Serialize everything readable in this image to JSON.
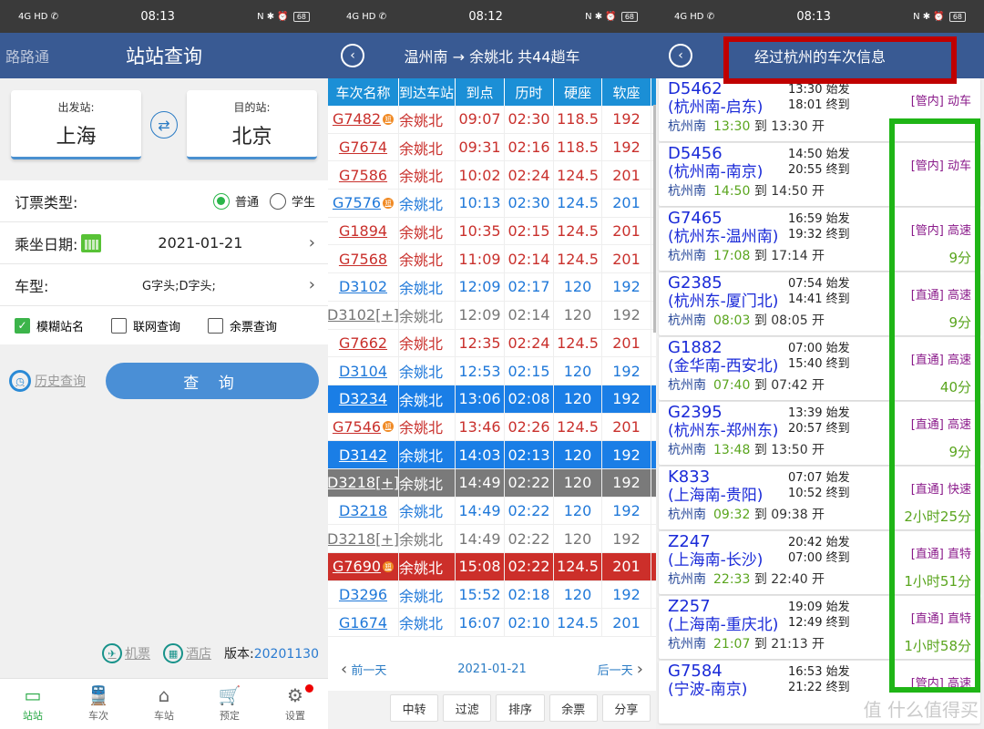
{
  "panel1": {
    "status": {
      "time": "08:13",
      "left": "4G HD ✆",
      "right": "N ✱ ⏰",
      "battery": "68"
    },
    "header": {
      "app_name": "路路通",
      "title": "站站查询"
    },
    "from": {
      "label": "出发站:",
      "value": "上海"
    },
    "to": {
      "label": "目的站:",
      "value": "北京"
    },
    "swap_icon": "⇄",
    "ticket_type": {
      "label": "订票类型:",
      "options": [
        "普通",
        "学生"
      ],
      "selected": "普通"
    },
    "date": {
      "label": "乘坐日期:",
      "value": "2021-01-21"
    },
    "train_type": {
      "label": "车型:",
      "value": "G字头;D字头;"
    },
    "checkboxes": [
      {
        "label": "模糊站名",
        "checked": true
      },
      {
        "label": "联网查询",
        "checked": false
      },
      {
        "label": "余票查询",
        "checked": false
      }
    ],
    "history_label": "历史查询",
    "query_label": "查 询",
    "links": {
      "flight": "机票",
      "hotel": "酒店",
      "version_label": "版本:",
      "version": "20201130"
    },
    "tabs": [
      {
        "label": "站站",
        "icon": "▭",
        "active": true
      },
      {
        "label": "车次",
        "icon": "🚆",
        "active": false
      },
      {
        "label": "车站",
        "icon": "⌂",
        "active": false
      },
      {
        "label": "预定",
        "icon": "🛒",
        "active": false
      },
      {
        "label": "设置",
        "icon": "⚙",
        "active": false
      }
    ]
  },
  "panel2": {
    "status": {
      "time": "08:12",
      "left": "4G HD ✆",
      "right": "N ✱ ⏰",
      "battery": "68"
    },
    "title": "温州南 → 余姚北 共44趟车",
    "columns": [
      "车次名称",
      "到达车站",
      "到点",
      "历时",
      "硬座",
      "软座"
    ],
    "rows": [
      {
        "train": "G7482",
        "badge": true,
        "station": "余姚北",
        "arrive": "09:07",
        "duration": "02:30",
        "hard": "118.5",
        "soft": "192",
        "style": "red"
      },
      {
        "train": "G7674",
        "badge": false,
        "station": "余姚北",
        "arrive": "09:31",
        "duration": "02:16",
        "hard": "118.5",
        "soft": "192",
        "style": "red"
      },
      {
        "train": "G7586",
        "badge": false,
        "station": "余姚北",
        "arrive": "10:02",
        "duration": "02:24",
        "hard": "124.5",
        "soft": "201",
        "style": "red"
      },
      {
        "train": "G7576",
        "badge": true,
        "station": "余姚北",
        "arrive": "10:13",
        "duration": "02:30",
        "hard": "124.5",
        "soft": "201",
        "style": "blue"
      },
      {
        "train": "G1894",
        "badge": false,
        "station": "余姚北",
        "arrive": "10:35",
        "duration": "02:15",
        "hard": "124.5",
        "soft": "201",
        "style": "red"
      },
      {
        "train": "G7568",
        "badge": false,
        "station": "余姚北",
        "arrive": "11:09",
        "duration": "02:14",
        "hard": "124.5",
        "soft": "201",
        "style": "red"
      },
      {
        "train": "D3102",
        "badge": false,
        "station": "余姚北",
        "arrive": "12:09",
        "duration": "02:17",
        "hard": "120",
        "soft": "192",
        "style": "blue"
      },
      {
        "train": "D3102[+]",
        "badge": false,
        "station": "余姚北",
        "arrive": "12:09",
        "duration": "02:14",
        "hard": "120",
        "soft": "192",
        "style": "gray"
      },
      {
        "train": "G7662",
        "badge": false,
        "station": "余姚北",
        "arrive": "12:35",
        "duration": "02:24",
        "hard": "124.5",
        "soft": "201",
        "style": "red"
      },
      {
        "train": "D3104",
        "badge": false,
        "station": "余姚北",
        "arrive": "12:53",
        "duration": "02:15",
        "hard": "120",
        "soft": "192",
        "style": "blue"
      },
      {
        "train": "D3234",
        "badge": false,
        "station": "余姚北",
        "arrive": "13:06",
        "duration": "02:08",
        "hard": "120",
        "soft": "192",
        "style": "sel-blue"
      },
      {
        "train": "G7546",
        "badge": true,
        "station": "余姚北",
        "arrive": "13:46",
        "duration": "02:26",
        "hard": "124.5",
        "soft": "201",
        "style": "red"
      },
      {
        "train": "D3142",
        "badge": false,
        "station": "余姚北",
        "arrive": "14:03",
        "duration": "02:13",
        "hard": "120",
        "soft": "192",
        "style": "sel-blue"
      },
      {
        "train": "D3218[+]",
        "badge": false,
        "station": "余姚北",
        "arrive": "14:49",
        "duration": "02:22",
        "hard": "120",
        "soft": "192",
        "style": "sel-gray"
      },
      {
        "train": "D3218",
        "badge": false,
        "station": "余姚北",
        "arrive": "14:49",
        "duration": "02:22",
        "hard": "120",
        "soft": "192",
        "style": "blue"
      },
      {
        "train": "D3218[+]",
        "badge": false,
        "station": "余姚北",
        "arrive": "14:49",
        "duration": "02:22",
        "hard": "120",
        "soft": "192",
        "style": "gray"
      },
      {
        "train": "G7690",
        "badge": true,
        "station": "余姚北",
        "arrive": "15:08",
        "duration": "02:22",
        "hard": "124.5",
        "soft": "201",
        "style": "sel-red"
      },
      {
        "train": "D3296",
        "badge": false,
        "station": "余姚北",
        "arrive": "15:52",
        "duration": "02:18",
        "hard": "120",
        "soft": "192",
        "style": "blue"
      },
      {
        "train": "G1674",
        "badge": false,
        "station": "余姚北",
        "arrive": "16:07",
        "duration": "02:10",
        "hard": "124.5",
        "soft": "201",
        "style": "blue"
      }
    ],
    "pager": {
      "prev": "前一天",
      "date": "2021-01-21",
      "next": "后一天"
    },
    "actions": [
      "中转",
      "过滤",
      "排序",
      "余票",
      "分享"
    ]
  },
  "panel3": {
    "status": {
      "time": "08:13",
      "left": "4G HD ✆",
      "right": "N ✱ ⏰",
      "battery": "68"
    },
    "title": "经过杭州的车次信息",
    "trains": [
      {
        "no": "D5462",
        "route": "(杭州南-启东)",
        "depart": "13:30 始发",
        "arrive": "18:01 终到",
        "type": "[管内] 动车",
        "station": "杭州南",
        "arr": "13:30",
        "dep": "到 13:30 开",
        "stay": ""
      },
      {
        "no": "D5456",
        "route": "(杭州南-南京)",
        "depart": "14:50 始发",
        "arrive": "20:55 终到",
        "type": "[管内] 动车",
        "station": "杭州南",
        "arr": "14:50",
        "dep": "到 14:50 开",
        "stay": ""
      },
      {
        "no": "G7465",
        "route": "(杭州东-温州南)",
        "depart": "16:59 始发",
        "arrive": "19:32 终到",
        "type": "[管内] 高速",
        "station": "杭州南",
        "arr": "17:08",
        "dep": "到 17:14 开",
        "stay": "9分"
      },
      {
        "no": "G2385",
        "route": "(杭州东-厦门北)",
        "depart": "07:54 始发",
        "arrive": "14:41 终到",
        "type": "[直通] 高速",
        "station": "杭州南",
        "arr": "08:03",
        "dep": "到 08:05 开",
        "stay": "9分"
      },
      {
        "no": "G1882",
        "route": "(金华南-西安北)",
        "depart": "07:00 始发",
        "arrive": "15:40 终到",
        "type": "[直通] 高速",
        "station": "杭州南",
        "arr": "07:40",
        "dep": "到 07:42 开",
        "stay": "40分"
      },
      {
        "no": "G2395",
        "route": "(杭州东-郑州东)",
        "depart": "13:39 始发",
        "arrive": "20:57 终到",
        "type": "[直通] 高速",
        "station": "杭州南",
        "arr": "13:48",
        "dep": "到 13:50 开",
        "stay": "9分"
      },
      {
        "no": "K833",
        "route": "(上海南-贵阳)",
        "depart": "07:07 始发",
        "arrive": "10:52 终到",
        "type": "[直通] 快速",
        "station": "杭州南",
        "arr": "09:32",
        "dep": "到 09:38 开",
        "stay": "2小时25分"
      },
      {
        "no": "Z247",
        "route": "(上海南-长沙)",
        "depart": "20:42 始发",
        "arrive": "07:00 终到",
        "type": "[直通] 直特",
        "station": "杭州南",
        "arr": "22:33",
        "dep": "到 22:40 开",
        "stay": "1小时51分"
      },
      {
        "no": "Z257",
        "route": "(上海南-重庆北)",
        "depart": "19:09 始发",
        "arrive": "12:49 终到",
        "type": "[直通] 直特",
        "station": "杭州南",
        "arr": "21:07",
        "dep": "到 21:13 开",
        "stay": "1小时58分"
      },
      {
        "no": "G7584",
        "route": "(宁波-南京)",
        "depart": "16:53 始发",
        "arrive": "21:22 终到",
        "type": "[管内] 高速",
        "station": "",
        "arr": "",
        "dep": "",
        "stay": ""
      }
    ],
    "watermark": "值 什么值得买",
    "highlight_colors": {
      "title_box": "#c00000",
      "column_box": "#1fb516"
    }
  }
}
